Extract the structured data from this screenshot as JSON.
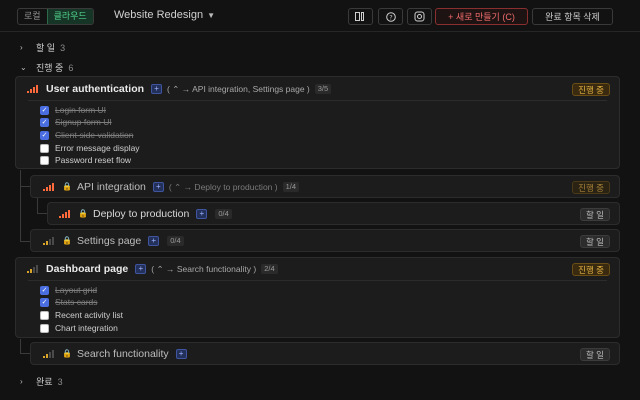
{
  "toolbar": {
    "mode_local": "로컬",
    "mode_cloud": "클라우드",
    "project": "Website Redesign",
    "new_label": "+ 새로 만들기 (C)",
    "clear_label": "완료 항목 삭제"
  },
  "sections": {
    "todo": {
      "label": "할 일",
      "count": "3"
    },
    "inprogress": {
      "label": "진행 중",
      "count": "6"
    },
    "done": {
      "label": "완료",
      "count": "3"
    }
  },
  "tasks": {
    "t1": {
      "title": "User authentication",
      "deps": "( ⌃ → API integration, Settings page )",
      "progress": "3/5",
      "status": "진행 중",
      "checklist": [
        {
          "label": "Login form UI",
          "done": true
        },
        {
          "label": "Signup form UI",
          "done": true
        },
        {
          "label": "Client-side validation",
          "done": true
        },
        {
          "label": "Error message display",
          "done": false
        },
        {
          "label": "Password reset flow",
          "done": false
        }
      ]
    },
    "t2": {
      "title": "API integration",
      "deps": "( ⌃ → Deploy to production )",
      "progress": "1/4",
      "status": "진행 중"
    },
    "t3": {
      "title": "Deploy to production",
      "progress": "0/4",
      "status": "할 일"
    },
    "t4": {
      "title": "Settings page",
      "progress": "0/4",
      "status": "할 일"
    },
    "t5": {
      "title": "Dashboard page",
      "deps": "( ⌃ → Search functionality )",
      "progress": "2/4",
      "status": "진행 중",
      "checklist": [
        {
          "label": "Layout grid",
          "done": true
        },
        {
          "label": "Stats cards",
          "done": true
        },
        {
          "label": "Recent activity list",
          "done": false
        },
        {
          "label": "Chart integration",
          "done": false
        }
      ]
    },
    "t6": {
      "title": "Search functionality",
      "status": "할 일"
    }
  },
  "colors": {
    "accent_green": "#4fd08a",
    "accent_red": "#f06b6b",
    "status_amber": "#e6b544",
    "check_blue": "#4a6ee0"
  }
}
